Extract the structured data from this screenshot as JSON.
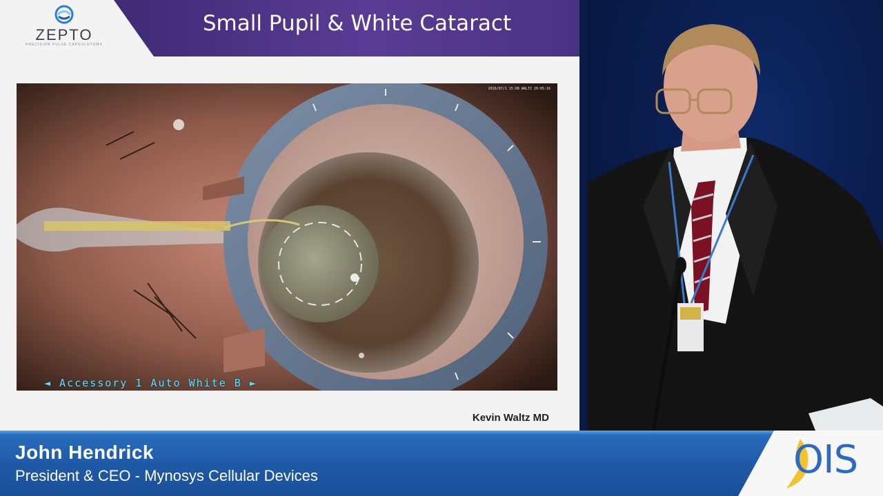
{
  "slide": {
    "logo": {
      "word": "ZEPTO",
      "tagline": "PRECISION PULSE CAPSULOTOMY"
    },
    "title": "Small Pupil & White Cataract",
    "video": {
      "timestamp": "2016/07/1 15:08 WALTZ 20:05:16",
      "osd": "◄ Accessory 1  Auto White B ►"
    },
    "credit": "Kevin Waltz MD"
  },
  "lower_third": {
    "name": "John Hendrick",
    "title": "President & CEO - Mynosys Cellular Devices"
  },
  "badge": {
    "text": "OIS",
    "accent_color": "#f2c230",
    "brand_color": "#2d6bc2"
  }
}
